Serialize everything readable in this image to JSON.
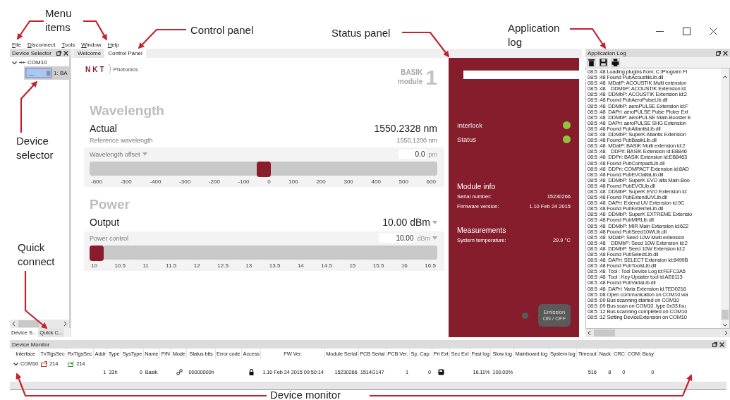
{
  "annotations": [
    {
      "text": "Menu items"
    },
    {
      "text": "Control panel"
    },
    {
      "text": "Status panel"
    },
    {
      "text": "Application log"
    },
    {
      "text": "Device selector"
    },
    {
      "text": "Quick connect"
    },
    {
      "text": "Device monitor"
    }
  ],
  "menu": [
    "File",
    "Disconnect",
    "Tools",
    "Window",
    "Help"
  ],
  "device_selector": {
    "title": "Device Selector",
    "tree": [
      {
        "label": "COM10",
        "expanded": true,
        "children": [
          {
            "label": "1: BA",
            "selected": true
          }
        ]
      }
    ],
    "tabs": [
      {
        "label": "Device S...",
        "selected": true
      },
      {
        "label": "Quick C...",
        "selected": false
      }
    ]
  },
  "tabs": [
    {
      "label": "Welcome",
      "selected": false
    },
    {
      "label": "Control Panel",
      "selected": true
    }
  ],
  "control_panel": {
    "logo": {
      "mark": "NKT",
      "name": "Photonics"
    },
    "module": {
      "name": "BASIK",
      "sub": "module",
      "number": "1"
    },
    "wavelength": {
      "title": "Wavelength",
      "actual_label": "Actual",
      "actual": "1550.2328 nm",
      "ref_label": "Reference wavelength",
      "ref": "1550.1200 nm",
      "offset": {
        "label": "Wavelength offset",
        "value": "0.0",
        "unit": "pm",
        "level": 0.5,
        "ticks": [
          "-600",
          "-500",
          "-400",
          "-300",
          "-200",
          "-100",
          "0",
          "100",
          "200",
          "300",
          "400",
          "500",
          "600"
        ]
      }
    },
    "power": {
      "title": "Power",
      "output_label": "Output",
      "output": "10.00 dBm",
      "control": {
        "label": "Power control",
        "value": "10.00",
        "unit": "dBm",
        "level": 0.0,
        "ticks": [
          "10",
          "10.5",
          "11",
          "11.5",
          "12",
          "12.5",
          "13",
          "13.5",
          "14",
          "14.5",
          "15",
          "15.5",
          "16",
          "16.5"
        ]
      }
    }
  },
  "status_panel": {
    "indicators": [
      {
        "label": "Interlock",
        "on": true
      },
      {
        "label": "Status",
        "on": true
      }
    ],
    "module_info": {
      "title": "Module info",
      "rows": [
        {
          "label": "Serial number:",
          "value": "15230266"
        },
        {
          "label": "Firmware version:",
          "value": "1.10 Feb 24 2015"
        }
      ]
    },
    "measurements": {
      "title": "Measurements",
      "rows": [
        {
          "label": "System temperature:",
          "value": "29.9 °C"
        }
      ]
    },
    "emission": {
      "label": "Emission",
      "sub": "ON / OFF",
      "on": false
    }
  },
  "application_log": {
    "title": "Application Log",
    "lines": [
      "08:5 :48 Loading plugins from: C:/Program Fi",
      "08:5 :48 Found PubAcoustikLib.dll",
      "08:5 :48  MDatP: ACOUSTIK Multi extension",
      "08:5 :48    DDMbP: ACOUSTIK Extension id:",
      "08:5 :48  DDMbP: ACOUSTIK Extension id:2",
      "08:5 :48 Found PubAeroPulseLib.dll",
      "08:5 :48  DDMbP: aeroPULSE Extension id:F",
      "08:5 :48  DAPri: aeroPULSE Pulse Picker Ext",
      "08:5 :48  DDMbP: aeroPULSE Main-Booster E",
      "08:5 :48  DAPri: aeroPULSE SHG Extension",
      "08:5 :48 Found PubAtlantisLib.dll",
      "08:5 :48  DDMbP: SuperK Atlantis Extension",
      "08:5 :48 Found PubBasikLib.dll",
      "08:5 :48  MDatP: BASIK Multi extension id:2",
      "08:5 :48    DDPri: BASIK Extension id:EB846",
      "08:5 :48  DDPri: BASIK Extension id:EB8463",
      "08:5 :48 Found PubCompactLib.dll",
      "08:5 :48  DDPri: COMPACT Extension id:8AD",
      "08:5 :48 Found PubEVOalfaLib.dll",
      "08:5 :48  DDMbP: SuperK EVO alfa Main-Boo",
      "08:5 :48 Found PubEVOLib.dll",
      "08:5 :48  DDMbP: SuperK EVO Extension id:",
      "08:5 :48 Found PubExtendUVLib.dll",
      "08:5 :48  DAPri: Extend UV Extension id:9C",
      "08:5 :48 Found PubExtremeLib.dll",
      "08:5 :48  DDMbP: SuperK EXTREME Extensio",
      "08:5 :48 Found PubMIRLib.dll",
      "08:5 :48  DDMbP: MIR Main Extension id:622",
      "08:5 :48 Found PubSeed10WLib.dll",
      "08:5 :48  MDatP: Seed 10W Multi extension",
      "08:5 :48    DDMbP: Seed 10W Extension id:2",
      "08:5 :48  DDMbP: Seed 10W Extension id:2",
      "08:5 :48 Found PubSelectLib.dll",
      "08:5 :48  DAPri: SELECT Extension id:8499B",
      "08:5 :48 Found PubToolsLib.dll",
      "08:5 :48  Tool : Tool Device Log id:FEFC3A5",
      "08:5 :48  Tool : Key Updater tool id:AE6113",
      "08:5 :48 Found PubVariaLib.dll",
      "08:5 :48  DAPri: Varia Extension id:7ED0216",
      "08:5 :08 Open communication on COM10 wa",
      "08:5 :09 Bus scanning started on COM10",
      "08:5 :09 Bus scan on COM10, type 0x33 fou",
      "08:5 :12 Bus scanning completed on COM10",
      "08:5 :12 Setting DeviceExtension on COM10"
    ]
  },
  "device_monitor": {
    "title": "Device Monitor",
    "columns": [
      "Interface",
      "TxTlgsSec",
      "RxTlgsSec",
      "Addr",
      "Type",
      "SysType",
      "Name",
      "P/N",
      "Mode",
      "Status bits",
      "Error code",
      "Access",
      "FW Ver.",
      "Module Serial",
      "PCB Serial",
      "PCB Ver.",
      "Sp. Cap.",
      "Pri Ext",
      "Sec Ext",
      "Fast log",
      "Slow log",
      "Mainboard log",
      "System log",
      "Timeout",
      "Nack",
      "CRC",
      "COM",
      "Busy"
    ],
    "interface_row": {
      "name": "COM10",
      "expanded": true,
      "tx": "214",
      "rx": "214"
    },
    "devices": [
      {
        "cells": [
          {
            "kind": "blank"
          },
          {
            "kind": "blank"
          },
          {
            "kind": "blank"
          },
          {
            "kind": "num",
            "text": "1"
          },
          {
            "kind": "text",
            "text": "33h"
          },
          {
            "kind": "num",
            "text": "0"
          },
          {
            "kind": "text",
            "text": "Basik"
          },
          {
            "kind": "blank"
          },
          {
            "kind": "icon"
          },
          {
            "kind": "text",
            "text": "00000000h"
          },
          {
            "kind": "blank"
          },
          {
            "kind": "icon"
          },
          {
            "kind": "text",
            "text": "1.10 Feb 24 2015 09:50:14"
          },
          {
            "kind": "num",
            "text": "15230266"
          },
          {
            "kind": "text",
            "text": "1514G147"
          },
          {
            "kind": "num",
            "text": "1"
          },
          {
            "kind": "num",
            "text": "0"
          },
          {
            "kind": "icon"
          },
          {
            "kind": "blank"
          },
          {
            "kind": "num",
            "text": "16.11%"
          },
          {
            "kind": "text",
            "text": "100.00%"
          },
          {
            "kind": "blank"
          },
          {
            "kind": "blank"
          },
          {
            "kind": "num",
            "text": "516"
          },
          {
            "kind": "num",
            "text": "8"
          },
          {
            "kind": "num",
            "text": "0"
          },
          {
            "kind": "blank"
          },
          {
            "kind": "num",
            "text": "0"
          }
        ]
      }
    ]
  }
}
